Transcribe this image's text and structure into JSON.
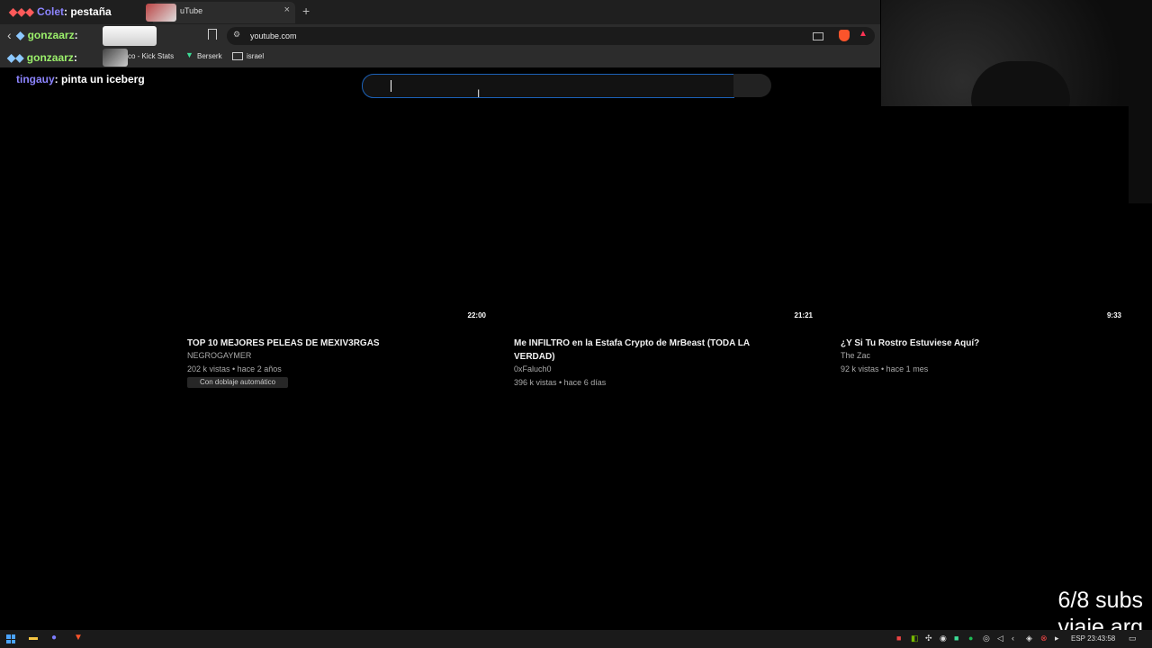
{
  "browser": {
    "tab_title": "uTube",
    "tab_close": "×",
    "new_tab": "+",
    "back": "‹",
    "url": "youtube.com",
    "bookmarks": [
      {
        "label": "co - Kick Stats"
      },
      {
        "label": "Berserk"
      },
      {
        "label": "israel"
      }
    ]
  },
  "chat": [
    {
      "user": "Colet",
      "text": ": pestaña"
    },
    {
      "user": "gonzaarz",
      "text": ":"
    },
    {
      "user": "gonzaarz",
      "text": ":"
    },
    {
      "user": "tingauy",
      "text": ": pinta un iceberg"
    }
  ],
  "search": {
    "placeholder": ""
  },
  "videos": [
    {
      "duration": "22:00",
      "title": "TOP 10 MEJORES PELEAS DE MEXIV3RGAS",
      "channel": "NEGROGAYMER",
      "meta": "202 k vistas • hace 2 años",
      "badge": "Con doblaje automático"
    },
    {
      "duration": "21:21",
      "title": "Me INFILTRO en la Estafa Crypto de MrBeast (TODA LA VERDAD)",
      "channel": "0xFaluch0",
      "meta": "396 k vistas • hace 6 días"
    },
    {
      "duration": "9:33",
      "title": "¿Y Si Tu Rostro Estuviese Aquí?",
      "channel": "The Zac",
      "meta": "92 k vistas • hace 1 mes"
    }
  ],
  "overlay": {
    "subs": "6/8 subs",
    "trip": "viaje arg"
  },
  "taskbar": {
    "language": "ESP",
    "time": "23:43:58"
  },
  "colors": {
    "accent": "#1c62b9",
    "brave": "#fb542b",
    "chat_green": "#9bf06b",
    "chat_purple": "#8c84ff"
  }
}
